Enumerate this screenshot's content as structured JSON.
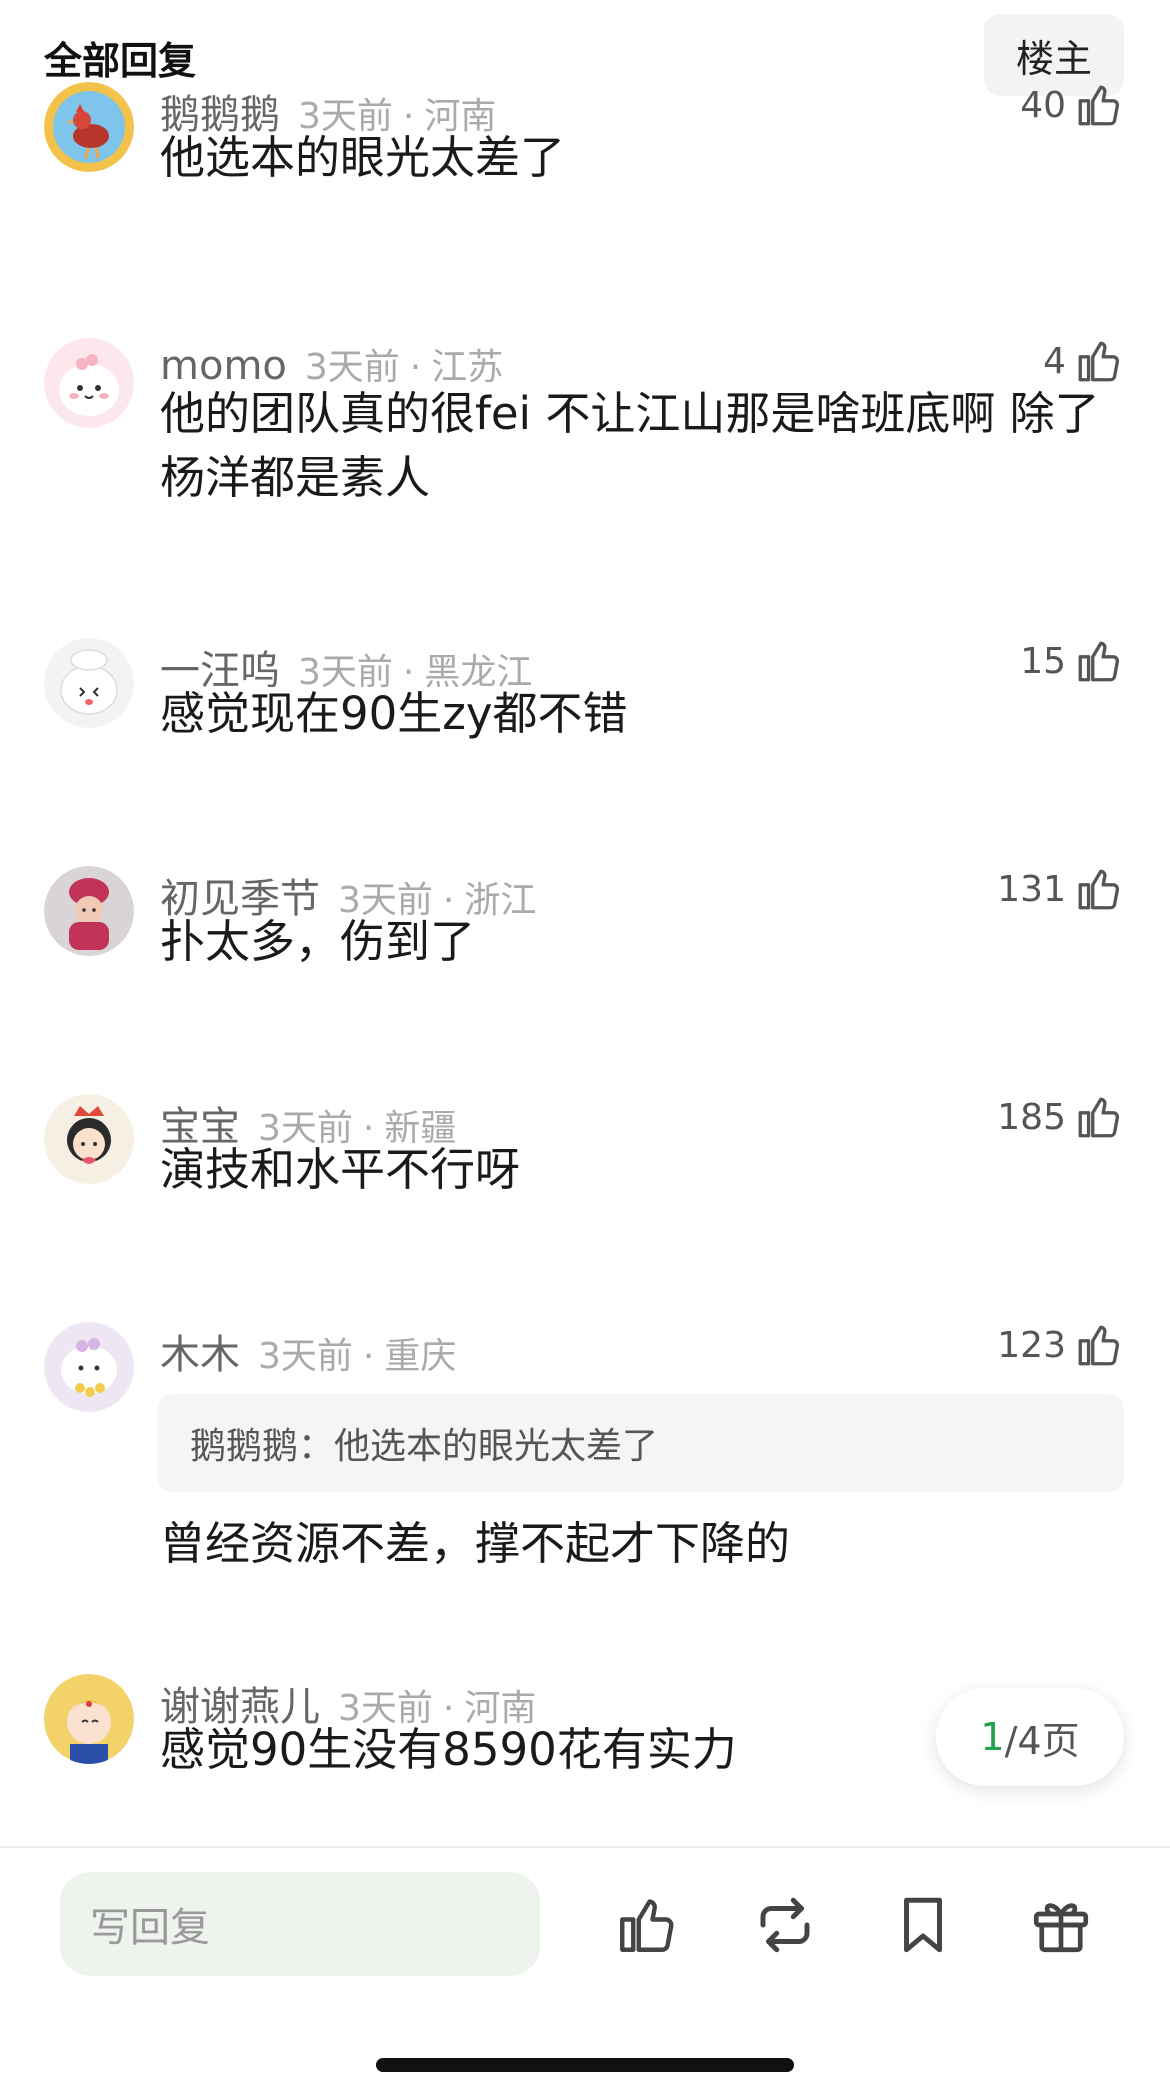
{
  "header": {
    "title": "全部回复",
    "owner_button": "楼主"
  },
  "comments": [
    {
      "user": "鹅鹅鹅",
      "time": "3天前",
      "location": "河南",
      "likes": "40",
      "text": "他选本的眼光太差了",
      "avatar_icon": "rooster-avatar-icon"
    },
    {
      "user": "momo",
      "time": "3天前",
      "location": "江苏",
      "likes": "4",
      "text": "他的团队真的很fei 不让江山那是啥班底啊 除了杨洋都是素人",
      "avatar_icon": "pink-cartoon-avatar-icon"
    },
    {
      "user": "一汪呜",
      "time": "3天前",
      "location": "黑龙江",
      "likes": "15",
      "text": "感觉现在90生zy都不错",
      "avatar_icon": "chef-bear-avatar-icon"
    },
    {
      "user": "初见季节",
      "time": "3天前",
      "location": "浙江",
      "likes": "131",
      "text": "扑太多，伤到了",
      "avatar_icon": "knit-doll-avatar-icon"
    },
    {
      "user": "宝宝",
      "time": "3天前",
      "location": "新疆",
      "likes": "185",
      "text": "演技和水平不行呀",
      "avatar_icon": "crown-girl-avatar-icon"
    },
    {
      "user": "木木",
      "time": "3天前",
      "location": "重庆",
      "likes": "123",
      "quote": "鹅鹅鹅：他选本的眼光太差了",
      "text": "曾经资源不差，撑不起才下降的",
      "avatar_icon": "flower-cartoon-avatar-icon"
    },
    {
      "user": "谢谢燕儿",
      "time": "3天前",
      "location": "河南",
      "text": "感觉90生没有8590花有实力",
      "avatar_icon": "sailor-moon-avatar-icon"
    }
  ],
  "pager": {
    "current": "1",
    "rest": "/4页"
  },
  "bottom_bar": {
    "reply_placeholder": "写回复"
  },
  "colors": {
    "accent_green": "#1fa44b",
    "muted_text": "#aaaaaa",
    "username": "#666666"
  }
}
